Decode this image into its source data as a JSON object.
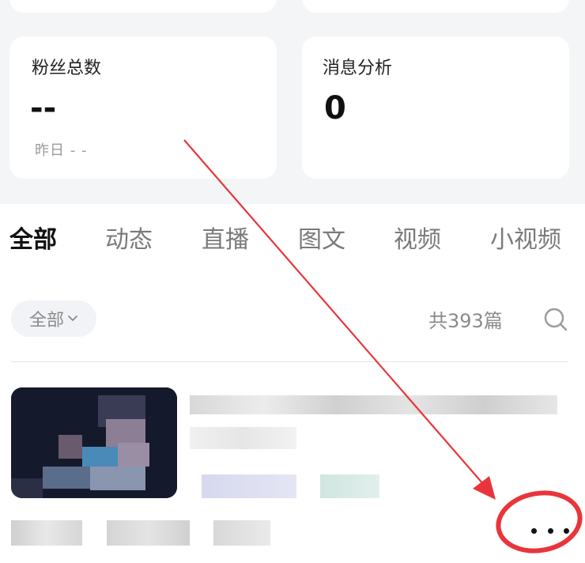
{
  "stats": {
    "fans": {
      "label": "粉丝总数",
      "value": "--",
      "sub": "昨日 - -"
    },
    "messages": {
      "label": "消息分析",
      "value": "0"
    }
  },
  "tabs": [
    {
      "label": "全部",
      "active": true
    },
    {
      "label": "动态"
    },
    {
      "label": "直播"
    },
    {
      "label": "图文"
    },
    {
      "label": "视频"
    },
    {
      "label": "小视频"
    }
  ],
  "filter": {
    "label": "全部",
    "icon": "chevron-down-icon"
  },
  "count_text": "共393篇",
  "search_icon": "search-icon",
  "post": {
    "thumbnail_icon": "blurred-thumbnail",
    "title": "",
    "more_icon": "more-dots-icon"
  },
  "annotation": {
    "arrow_color": "#e8353b",
    "circle_color": "#e8353b"
  }
}
